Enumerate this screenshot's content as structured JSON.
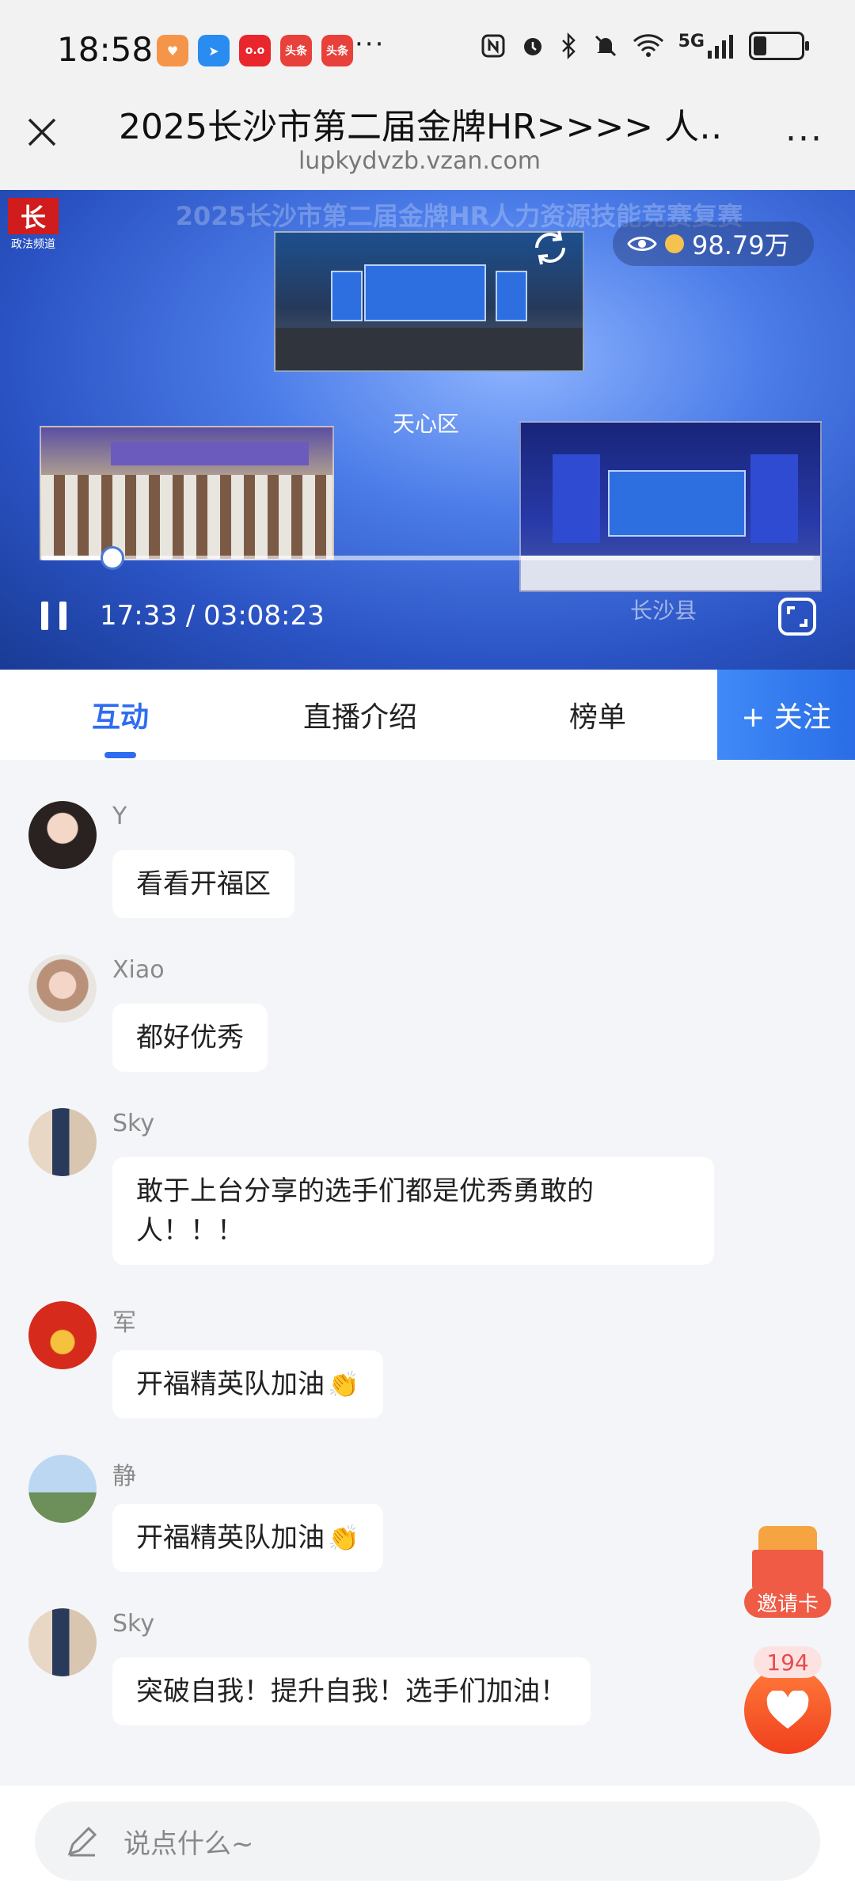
{
  "status_bar": {
    "time": "18:58",
    "app_icons": [
      {
        "name": "heart-app-icon",
        "color": "#f5954a",
        "text": "♥"
      },
      {
        "name": "arrow-app-icon",
        "color": "#2a8cf0",
        "text": "➤"
      },
      {
        "name": "tmall-app-icon",
        "color": "#e8262c",
        "text": "o.o"
      },
      {
        "name": "toutiao-app-icon-1",
        "color": "#e8403a",
        "text": "头条"
      },
      {
        "name": "toutiao-app-icon-2",
        "color": "#e8403a",
        "text": "头条"
      }
    ],
    "more": "···",
    "network": "5G"
  },
  "header": {
    "title": "2025长沙市第二届金牌HR>>>> 人…",
    "url": "lupkydvzb.vzan.com",
    "more": "···"
  },
  "video": {
    "channel_logo": "长",
    "channel_name": "政法频道",
    "banner": "2025长沙市第二届金牌HR人力资源技能竞赛复赛",
    "views": "98.79万",
    "progress": 0.092,
    "time_display": "17:33 / 03:08:23",
    "panels": {
      "a_caption": "天心区",
      "c_caption": "长沙县"
    }
  },
  "tabs": {
    "items": [
      {
        "label": "互动",
        "active": true
      },
      {
        "label": "直播介绍",
        "active": false
      },
      {
        "label": "榜单",
        "active": false
      }
    ],
    "follow": "+ 关注"
  },
  "messages": [
    {
      "user": "Y",
      "text": "看看开福区",
      "avatar": "photo-girl-1"
    },
    {
      "user": "Xiao",
      "text": "都好优秀",
      "avatar": "photo-girl-2"
    },
    {
      "user": "Sky",
      "text": "敢于上台分享的选手们都是优秀勇敢的人！！！",
      "avatar": "photo-couple"
    },
    {
      "user": "军",
      "text": "开福精英队加油",
      "clap": "👏",
      "avatar": "cartoon-red"
    },
    {
      "user": "静",
      "text": "开福精英队加油",
      "clap": "👏",
      "avatar": "photo-balloons"
    },
    {
      "user": "Sky",
      "text": "突破自我！提升自我！选手们加油！",
      "avatar": "photo-couple"
    }
  ],
  "floating": {
    "invite_label": "邀请卡",
    "likes": "194"
  },
  "input": {
    "placeholder": "说点什么~"
  },
  "colors": {
    "accent": "#2e6df0",
    "like": "#f0401d",
    "invite": "#ef5b45"
  }
}
